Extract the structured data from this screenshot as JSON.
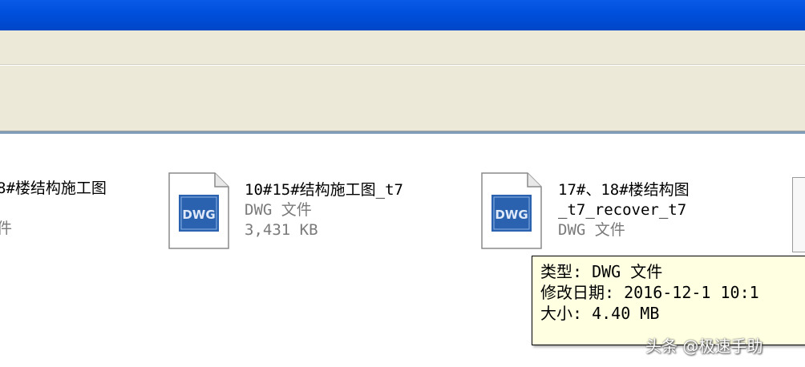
{
  "files": [
    {
      "name": "8#楼结构施工图",
      "type": "",
      "size": "",
      "partial_type": "件"
    },
    {
      "name": "10#15#结构施工图_t7",
      "type": "DWG 文件",
      "size": "3,431 KB"
    },
    {
      "name_line1": "17#、18#楼结构图",
      "name_line2": "_t7_recover_t7",
      "type": "DWG 文件"
    }
  ],
  "icon": {
    "name": "dwg-file-icon",
    "label": "DWG",
    "badge_color": "#2a62b0"
  },
  "tooltip": {
    "type_line": "类型: DWG 文件",
    "date_line": "修改日期: 2016-12-1 10:1",
    "size_line": "大小: 4.40 MB"
  },
  "watermark": "头条 @极速手助",
  "colors": {
    "titlebar": "#0050dd",
    "chrome": "#ece9d8",
    "tooltip_bg": "#ffffe1"
  }
}
